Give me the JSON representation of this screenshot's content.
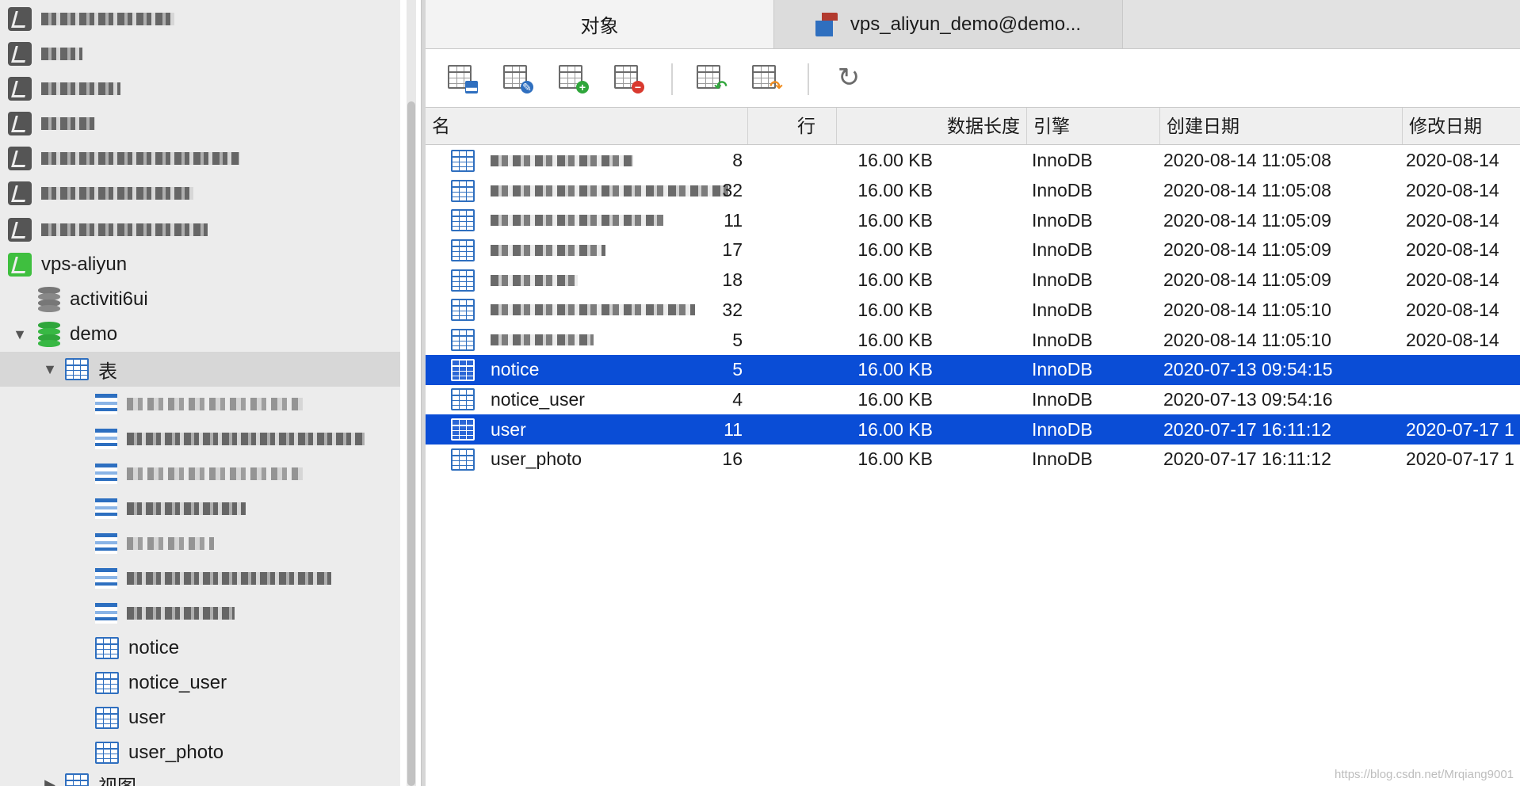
{
  "sidebar": {
    "connection": "vps-aliyun",
    "db_activiti": "activiti6ui",
    "db_demo": "demo",
    "tables_node": "表",
    "tables": [
      "notice",
      "notice_user",
      "user",
      "user_photo"
    ],
    "views_node": "视图"
  },
  "tabs": {
    "objects": "对象",
    "query": "vps_aliyun_demo@demo..."
  },
  "columns": {
    "name": "名",
    "rows": "行",
    "data_length": "数据长度",
    "engine": "引擎",
    "created": "创建日期",
    "modified": "修改日期"
  },
  "table_rows": [
    {
      "name": "",
      "rows": "8",
      "data_length": "16.00 KB",
      "engine": "InnoDB",
      "created": "2020-08-14 11:05:08",
      "modified": "2020-08-14"
    },
    {
      "name": "",
      "rows": "32",
      "data_length": "16.00 KB",
      "engine": "InnoDB",
      "created": "2020-08-14 11:05:08",
      "modified": "2020-08-14"
    },
    {
      "name": "",
      "rows": "11",
      "data_length": "16.00 KB",
      "engine": "InnoDB",
      "created": "2020-08-14 11:05:09",
      "modified": "2020-08-14"
    },
    {
      "name": "",
      "rows": "17",
      "data_length": "16.00 KB",
      "engine": "InnoDB",
      "created": "2020-08-14 11:05:09",
      "modified": "2020-08-14"
    },
    {
      "name": "",
      "rows": "18",
      "data_length": "16.00 KB",
      "engine": "InnoDB",
      "created": "2020-08-14 11:05:09",
      "modified": "2020-08-14"
    },
    {
      "name": "",
      "rows": "32",
      "data_length": "16.00 KB",
      "engine": "InnoDB",
      "created": "2020-08-14 11:05:10",
      "modified": "2020-08-14"
    },
    {
      "name": "",
      "rows": "5",
      "data_length": "16.00 KB",
      "engine": "InnoDB",
      "created": "2020-08-14 11:05:10",
      "modified": "2020-08-14"
    },
    {
      "name": "notice",
      "rows": "5",
      "data_length": "16.00 KB",
      "engine": "InnoDB",
      "created": "2020-07-13 09:54:15",
      "modified": ""
    },
    {
      "name": "notice_user",
      "rows": "4",
      "data_length": "16.00 KB",
      "engine": "InnoDB",
      "created": "2020-07-13 09:54:16",
      "modified": ""
    },
    {
      "name": "user",
      "rows": "11",
      "data_length": "16.00 KB",
      "engine": "InnoDB",
      "created": "2020-07-17 16:11:12",
      "modified": "2020-07-17 1"
    },
    {
      "name": "user_photo",
      "rows": "16",
      "data_length": "16.00 KB",
      "engine": "InnoDB",
      "created": "2020-07-17 16:11:12",
      "modified": "2020-07-17 1"
    }
  ],
  "selected_row_indices": [
    7,
    9
  ],
  "watermark": "https://blog.csdn.net/Mrqiang9001",
  "colors": {
    "selection": "#0a4dd6",
    "table_icon": "#2f6fbf",
    "connection_green": "#3fbf3f",
    "db_green": "#2fa63b"
  }
}
